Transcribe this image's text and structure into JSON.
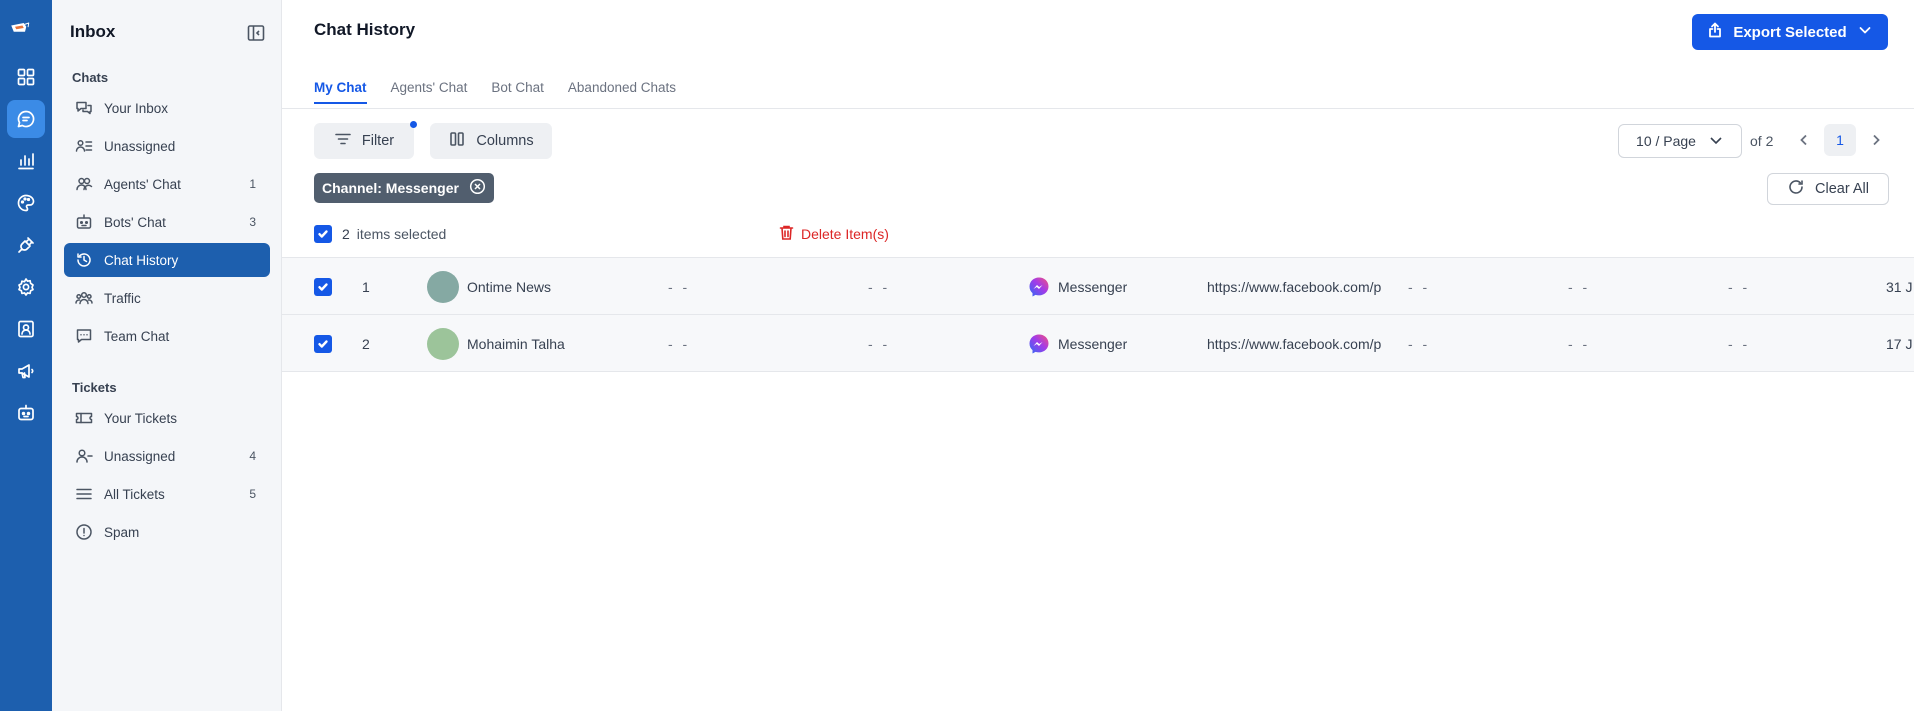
{
  "sidebar": {
    "title": "Inbox",
    "chats_heading": "Chats",
    "chats": [
      {
        "label": "Your Inbox",
        "count": "",
        "icon": "chat-bubbles-icon"
      },
      {
        "label": "Unassigned",
        "count": "",
        "icon": "user-list-icon"
      },
      {
        "label": "Agents' Chat",
        "count": "1",
        "icon": "users-icon"
      },
      {
        "label": "Bots' Chat",
        "count": "3",
        "icon": "bot-icon"
      },
      {
        "label": "Chat History",
        "count": "",
        "icon": "history-icon",
        "active": true
      },
      {
        "label": "Traffic",
        "count": "",
        "icon": "group-icon"
      },
      {
        "label": "Team Chat",
        "count": "",
        "icon": "message-square-icon"
      }
    ],
    "tickets_heading": "Tickets",
    "tickets": [
      {
        "label": "Your Tickets",
        "count": "",
        "icon": "ticket-icon"
      },
      {
        "label": "Unassigned",
        "count": "4",
        "icon": "user-minus-icon"
      },
      {
        "label": "All Tickets",
        "count": "5",
        "icon": "list-icon"
      },
      {
        "label": "Spam",
        "count": "",
        "icon": "alert-circle-icon"
      }
    ]
  },
  "header": {
    "title": "Chat History",
    "export_label": "Export Selected"
  },
  "tabs": [
    {
      "label": "My Chat",
      "active": true
    },
    {
      "label": "Agents' Chat"
    },
    {
      "label": "Bot Chat"
    },
    {
      "label": "Abandoned Chats"
    }
  ],
  "toolbar": {
    "filter_label": "Filter",
    "columns_label": "Columns",
    "per_page": "10 / Page",
    "of_pages": "of 2",
    "current_page": "1",
    "clear_all": "Clear All"
  },
  "filter_chip": {
    "label": "Channel: Messenger"
  },
  "selection": {
    "count": "2",
    "text": "items selected",
    "delete_label": "Delete Item(s)"
  },
  "rows": [
    {
      "index": "1",
      "name": "Ontime News",
      "avatar_color": "#85a9a3",
      "col3": "- -",
      "col4": "- -",
      "channel": "Messenger",
      "url": "https://www.facebook.com/pro",
      "col7": "- -",
      "col8": "- -",
      "col9": "- -",
      "date": "31 J"
    },
    {
      "index": "2",
      "name": "Mohaimin Talha",
      "avatar_color": "#9cc49a",
      "col3": "- -",
      "col4": "- -",
      "channel": "Messenger",
      "url": "https://www.facebook.com/pro",
      "col7": "- -",
      "col8": "- -",
      "col9": "- -",
      "date": "17 J"
    }
  ],
  "colors": {
    "rail": "#1d5fae",
    "primary": "#1558e6",
    "chip": "#515e6e",
    "danger": "#dc2626"
  }
}
